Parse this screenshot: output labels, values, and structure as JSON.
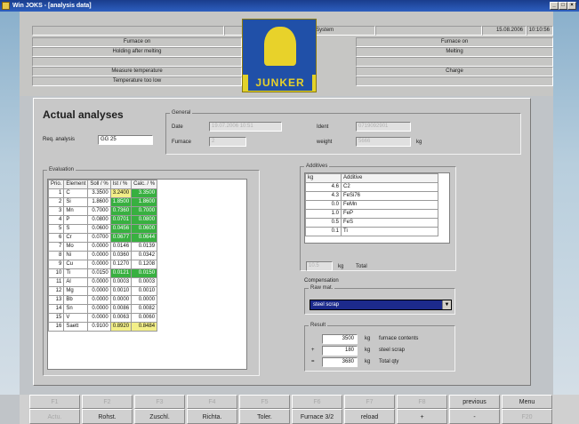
{
  "window": {
    "title": "Win JOKS - [analysis data]"
  },
  "header": {
    "center_title": "Junker Ofen Kontroll System",
    "date": "15.08.2006",
    "time": "10:10:56",
    "left_status": [
      "Furnace on",
      "Holding after melting",
      "",
      "Measure temperature",
      "Temperature too low"
    ],
    "right_status": [
      "Furnace on",
      "Melting",
      "",
      "Charge",
      ""
    ],
    "logo_text": "JUNKER"
  },
  "actual": {
    "title": "Actual analyses",
    "req_label": "Req. analysis",
    "req_value": "GG 25",
    "general_title": "General",
    "date_label": "Date",
    "date_value": "19.07.2006 10:51",
    "ident_label": "Ident",
    "ident_value": "0719092901",
    "furnace_label": "Furnace",
    "furnace_value": "2",
    "weight_label": "weight",
    "weight_value": "5666",
    "weight_unit": "kg"
  },
  "evaluation": {
    "title": "Evaluation",
    "columns": [
      "Prio.",
      "Element",
      "Soll / %",
      "Ist / %",
      "Calc. / %"
    ],
    "rows": [
      {
        "prio": "1",
        "element": "C",
        "soll": "3.3500",
        "ist": "3.2400",
        "calc": "3.3500",
        "ist_c": "y",
        "calc_c": "g"
      },
      {
        "prio": "2",
        "element": "Si",
        "soll": "1.8600",
        "ist": "1.8500",
        "calc": "1.8600",
        "ist_c": "g",
        "calc_c": "g"
      },
      {
        "prio": "3",
        "element": "Mn",
        "soll": "0.7000",
        "ist": "0.7360",
        "calc": "0.7000",
        "ist_c": "g",
        "calc_c": "g"
      },
      {
        "prio": "4",
        "element": "P",
        "soll": "0.0800",
        "ist": "0.0701",
        "calc": "0.0800",
        "ist_c": "g",
        "calc_c": "g"
      },
      {
        "prio": "5",
        "element": "S",
        "soll": "0.0600",
        "ist": "0.0456",
        "calc": "0.0600",
        "ist_c": "g",
        "calc_c": "g"
      },
      {
        "prio": "6",
        "element": "Cr",
        "soll": "0.0700",
        "ist": "0.0677",
        "calc": "0.0644",
        "ist_c": "g",
        "calc_c": "g"
      },
      {
        "prio": "7",
        "element": "Mo",
        "soll": "0.0000",
        "ist": "0.0146",
        "calc": "0.0139",
        "ist_c": "",
        "calc_c": ""
      },
      {
        "prio": "8",
        "element": "Ni",
        "soll": "0.0000",
        "ist": "0.0360",
        "calc": "0.0342",
        "ist_c": "",
        "calc_c": ""
      },
      {
        "prio": "9",
        "element": "Cu",
        "soll": "0.0000",
        "ist": "0.1270",
        "calc": "0.1208",
        "ist_c": "",
        "calc_c": ""
      },
      {
        "prio": "10",
        "element": "Ti",
        "soll": "0.0150",
        "ist": "0.0121",
        "calc": "0.0150",
        "ist_c": "g",
        "calc_c": "g"
      },
      {
        "prio": "11",
        "element": "Al",
        "soll": "0.0000",
        "ist": "0.0003",
        "calc": "0.0003",
        "ist_c": "",
        "calc_c": ""
      },
      {
        "prio": "12",
        "element": "Mg",
        "soll": "0.0000",
        "ist": "0.0010",
        "calc": "0.0010",
        "ist_c": "",
        "calc_c": ""
      },
      {
        "prio": "13",
        "element": "Bb",
        "soll": "0.0000",
        "ist": "0.0000",
        "calc": "0.0000",
        "ist_c": "",
        "calc_c": ""
      },
      {
        "prio": "14",
        "element": "Sn",
        "soll": "0.0000",
        "ist": "0.0086",
        "calc": "0.0082",
        "ist_c": "",
        "calc_c": ""
      },
      {
        "prio": "15",
        "element": "V",
        "soll": "0.0000",
        "ist": "0.0063",
        "calc": "0.0060",
        "ist_c": "",
        "calc_c": ""
      },
      {
        "prio": "16",
        "element": "Saett",
        "soll": "0.9100",
        "ist": "0.8920",
        "calc": "0.8484",
        "ist_c": "y",
        "calc_c": "y"
      }
    ]
  },
  "additives": {
    "title": "Additives",
    "columns": [
      "kg",
      "Additive"
    ],
    "rows": [
      {
        "kg": "4.6",
        "name": "C2"
      },
      {
        "kg": "4.3",
        "name": "FeSi76"
      },
      {
        "kg": "0.0",
        "name": "FeMn"
      },
      {
        "kg": "1.0",
        "name": "FeP"
      },
      {
        "kg": "0.5",
        "name": "FeS"
      },
      {
        "kg": "0.1",
        "name": "Ti"
      }
    ],
    "total_value": "10.5",
    "total_unit": "kg",
    "total_label": "Total"
  },
  "compensation": {
    "title": "Compensation",
    "raw_title": "Raw mat.",
    "raw_selected": "steel scrap",
    "dropdown_glyph": "▼",
    "result_title": "Result",
    "result_rows": [
      {
        "op": "",
        "value": "3500",
        "unit": "kg",
        "label": "furnace contents"
      },
      {
        "op": "+",
        "value": "180",
        "unit": "kg",
        "label": "steel scrap"
      },
      {
        "op": "=",
        "value": "3680",
        "unit": "kg",
        "label": "Total qty"
      }
    ]
  },
  "fkeys": [
    {
      "top": "F1",
      "bottom": "Actu.",
      "top_dim": true,
      "bottom_dim": true
    },
    {
      "top": "F2",
      "bottom": "Rohst.",
      "top_dim": true,
      "bottom_dim": false
    },
    {
      "top": "F3",
      "bottom": "Zuschl.",
      "top_dim": true,
      "bottom_dim": false
    },
    {
      "top": "F4",
      "bottom": "Richta.",
      "top_dim": true,
      "bottom_dim": false
    },
    {
      "top": "F5",
      "bottom": "Toler.",
      "top_dim": true,
      "bottom_dim": false
    },
    {
      "top": "F6",
      "bottom": "Furnace 3/2",
      "top_dim": true,
      "bottom_dim": false
    },
    {
      "top": "F7",
      "bottom": "reload",
      "top_dim": true,
      "bottom_dim": false
    },
    {
      "top": "F8",
      "bottom": "+",
      "top_dim": true,
      "bottom_dim": false
    },
    {
      "top": "previous",
      "bottom": "-",
      "top_dim": false,
      "bottom_dim": false
    },
    {
      "top": "Menu",
      "bottom": "F20",
      "top_dim": false,
      "bottom_dim": true
    }
  ]
}
